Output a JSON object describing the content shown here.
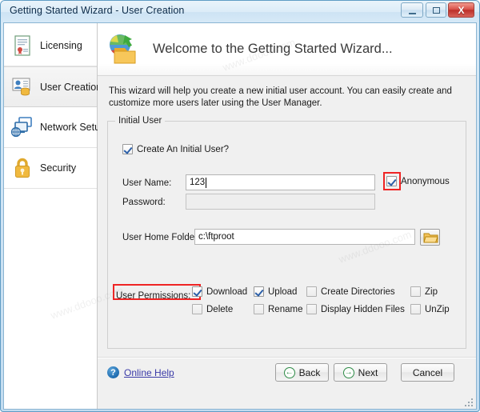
{
  "window": {
    "title": "Getting Started Wizard - User Creation",
    "minimize_label": "Minimize",
    "maximize_label": "Restore",
    "close_label": "X"
  },
  "sidebar": {
    "items": [
      {
        "label": "Licensing",
        "icon": "certificate-icon",
        "selected": false
      },
      {
        "label": "User Creation",
        "icon": "user-card-icon",
        "selected": true
      },
      {
        "label": "Network Setup",
        "icon": "network-icon",
        "selected": false
      },
      {
        "label": "Security",
        "icon": "padlock-icon",
        "selected": false
      }
    ]
  },
  "banner": {
    "icon": "globe-folder-icon",
    "title": "Welcome to the Getting Started Wizard..."
  },
  "intro": {
    "text": "This wizard will help you create a new initial user account.  You can easily create and customize more users later using the User Manager."
  },
  "form": {
    "group_legend": "Initial User",
    "create_initial_user": {
      "label": "Create An Initial User?",
      "checked": true
    },
    "user_name": {
      "label": "User Name:",
      "value": "123",
      "placeholder": ""
    },
    "anonymous": {
      "label": "Anonymous",
      "checked": true,
      "highlighted": true
    },
    "password": {
      "label": "Password:",
      "value": "",
      "placeholder": "",
      "disabled": true
    },
    "home_folder": {
      "label": "User Home Folder:",
      "value": "c:\\ftproot",
      "placeholder": ""
    },
    "browse_button": {
      "icon": "folder-open-icon"
    },
    "permissions": {
      "label": "User Permissions:",
      "highlighted": true,
      "items": [
        {
          "label": "Download",
          "checked": true
        },
        {
          "label": "Delete",
          "checked": false
        },
        {
          "label": "Upload",
          "checked": true
        },
        {
          "label": "Rename",
          "checked": false
        },
        {
          "label": "Create Directories",
          "checked": false
        },
        {
          "label": "Display Hidden Files",
          "checked": false
        },
        {
          "label": "Zip",
          "checked": false
        },
        {
          "label": "UnZip",
          "checked": false
        }
      ]
    }
  },
  "footer": {
    "help_icon": "?",
    "help_label": "Online Help",
    "back_label": "Back",
    "next_label": "Next",
    "cancel_label": "Cancel",
    "back_arrow": "←",
    "next_arrow": "→"
  },
  "colors": {
    "accent_blue": "#2b5fa8",
    "annotation_red": "#ef2424",
    "link_purple": "#3b3ba8",
    "arrow_green": "#2e8b47"
  }
}
